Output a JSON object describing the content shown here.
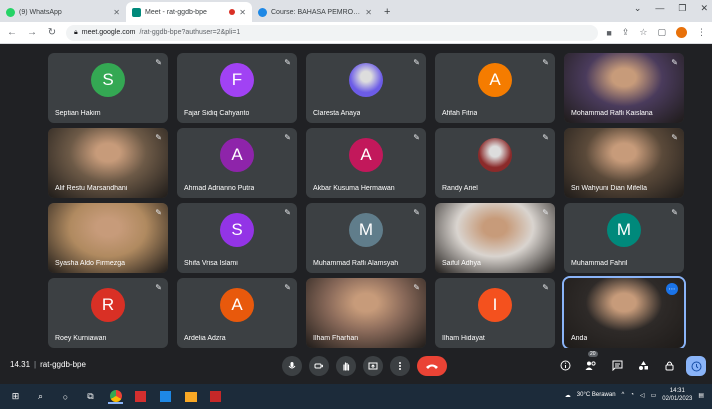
{
  "browser": {
    "tabs": [
      {
        "title": "(9) WhatsApp",
        "favicon_color": "#25d366",
        "active": false
      },
      {
        "title": "Meet - rat-ggdb-bpe",
        "favicon_color": "#00897b",
        "active": true
      },
      {
        "title": "Course: BAHASA PEMROGRAMAN",
        "favicon_color": "#1e88e5",
        "active": false
      }
    ],
    "url_host": "meet.google.com",
    "url_path": "/rat-ggdb-bpe?authuser=2&pli=1"
  },
  "participants": [
    {
      "name": "Septian Hakim",
      "initial": "S",
      "color": "#34a853",
      "kind": "avatar"
    },
    {
      "name": "Fajar Sidiq Cahyanto",
      "initial": "F",
      "color": "#a142f4",
      "kind": "avatar"
    },
    {
      "name": "Claresta Anaya",
      "initial": "",
      "color": "#6c5ce7",
      "kind": "photo"
    },
    {
      "name": "Afifah Fitria",
      "initial": "A",
      "color": "#f57c00",
      "kind": "avatar"
    },
    {
      "name": "Mohammad Rafli Kaislana",
      "initial": "",
      "color": "#4a3b5c",
      "kind": "video"
    },
    {
      "name": "Alif Restu Marsandhani",
      "initial": "",
      "color": "#6d5a47",
      "kind": "video"
    },
    {
      "name": "Ahmad Adrianno Putra",
      "initial": "A",
      "color": "#8e24aa",
      "kind": "avatar"
    },
    {
      "name": "Akbar Kusuma Hermawan",
      "initial": "A",
      "color": "#c2185b",
      "kind": "avatar"
    },
    {
      "name": "Randy Ariel",
      "initial": "",
      "color": "#8b2a2a",
      "kind": "photo"
    },
    {
      "name": "Sri Wahyuni Dian Mifella",
      "initial": "",
      "color": "#5b4a3a",
      "kind": "video"
    },
    {
      "name": "Syasha Aldo Firmezga",
      "initial": "",
      "color": "#b08a60",
      "kind": "video"
    },
    {
      "name": "Shifa Vrisa Islami",
      "initial": "S",
      "color": "#9334e6",
      "kind": "avatar"
    },
    {
      "name": "Muhammad Rafli Alamsyah",
      "initial": "M",
      "color": "#607d8b",
      "kind": "avatar"
    },
    {
      "name": "Saiful Adhya",
      "initial": "",
      "color": "#d9d4cf",
      "kind": "video"
    },
    {
      "name": "Muhammad Fahril",
      "initial": "M",
      "color": "#00897b",
      "kind": "avatar"
    },
    {
      "name": "Roey Kurniawan",
      "initial": "R",
      "color": "#d93025",
      "kind": "avatar"
    },
    {
      "name": "Ardelia Adzra",
      "initial": "A",
      "color": "#e8590c",
      "kind": "avatar"
    },
    {
      "name": "Ilham Fharhan",
      "initial": "",
      "color": "#8a6a5a",
      "kind": "video"
    },
    {
      "name": "Ilham Hidayat",
      "initial": "I",
      "color": "#f4511e",
      "kind": "avatar"
    },
    {
      "name": "Anda",
      "initial": "",
      "color": "#2e2a28",
      "kind": "self"
    }
  ],
  "meeting": {
    "time": "14.31",
    "code": "rat-ggdb-bpe",
    "participant_count": "20"
  },
  "taskbar": {
    "weather": "30°C Berawan",
    "time": "14:31",
    "date": "02/01/2023"
  }
}
